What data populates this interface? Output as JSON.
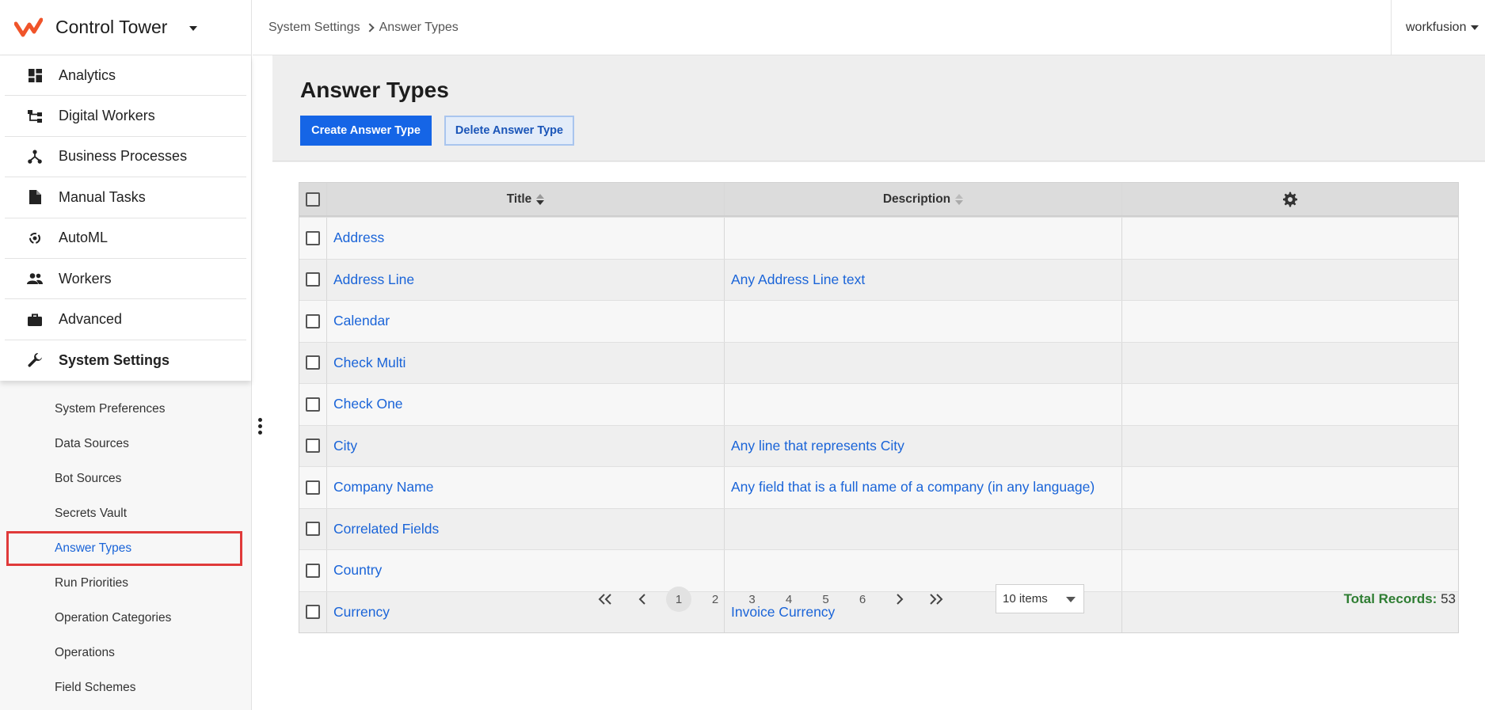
{
  "app": {
    "title": "Control Tower",
    "user": "workfusion"
  },
  "breadcrumb": {
    "parent": "System Settings",
    "current": "Answer Types"
  },
  "nav": [
    {
      "label": "Analytics",
      "icon": "dashboard-icon"
    },
    {
      "label": "Digital Workers",
      "icon": "workflow-icon"
    },
    {
      "label": "Business Processes",
      "icon": "process-icon"
    },
    {
      "label": "Manual Tasks",
      "icon": "document-icon"
    },
    {
      "label": "AutoML",
      "icon": "automl-icon"
    },
    {
      "label": "Workers",
      "icon": "people-icon"
    },
    {
      "label": "Advanced",
      "icon": "briefcase-icon"
    },
    {
      "label": "System Settings",
      "icon": "wrench-icon",
      "active": true
    }
  ],
  "subnav": [
    "System Preferences",
    "Data Sources",
    "Bot Sources",
    "Secrets Vault",
    "Answer Types",
    "Run Priorities",
    "Operation Categories",
    "Operations",
    "Field Schemes"
  ],
  "page": {
    "title": "Answer Types",
    "create_label": "Create Answer Type",
    "delete_label": "Delete Answer Type"
  },
  "table": {
    "columns": {
      "title": "Title",
      "description": "Description"
    },
    "rows": [
      {
        "title": "Address",
        "description": ""
      },
      {
        "title": "Address Line",
        "description": "Any Address Line text"
      },
      {
        "title": "Calendar",
        "description": ""
      },
      {
        "title": "Check Multi",
        "description": ""
      },
      {
        "title": "Check One",
        "description": ""
      },
      {
        "title": "City",
        "description": "Any line that represents City"
      },
      {
        "title": "Company Name",
        "description": "Any field that is a full name of a company (in any language)"
      },
      {
        "title": "Correlated Fields",
        "description": ""
      },
      {
        "title": "Country",
        "description": ""
      },
      {
        "title": "Currency",
        "description": "Invoice Currency"
      }
    ]
  },
  "pagination": {
    "pages": [
      "1",
      "2",
      "3",
      "4",
      "5",
      "6"
    ],
    "current": "1",
    "page_size": "10 items",
    "total_label": "Total Records:",
    "total_value": "53"
  },
  "colors": {
    "accent": "#1565e6",
    "link": "#1a64d8",
    "highlight": "#e03a3a",
    "brand": "#f0542a",
    "total": "#2e7d32"
  }
}
